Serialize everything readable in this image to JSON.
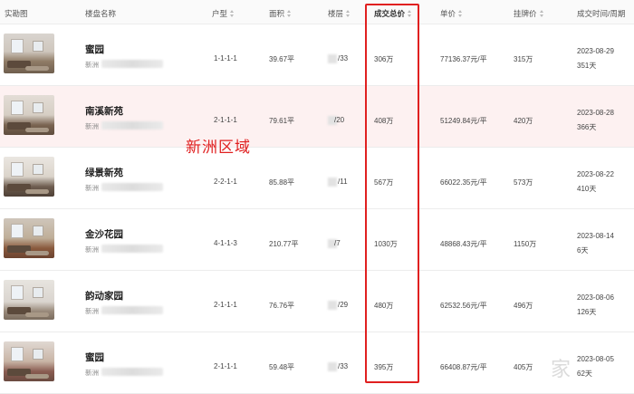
{
  "header": {
    "photo": "实勘图",
    "name": "楼盘名称",
    "layout": "户型",
    "area": "面积",
    "floor": "楼层",
    "total": "成交总价",
    "unit": "单价",
    "list": "挂牌价",
    "time": "成交时间/周期"
  },
  "annotation": "新洲区域",
  "watermark": "家",
  "rows": [
    {
      "name": "蜜园",
      "district": "新洲",
      "layout": "1-1-1-1",
      "area": "39.67平",
      "floor": "/33",
      "total": "306万",
      "unit": "77136.37元/平",
      "list": "315万",
      "date": "2023-08-29",
      "days": "351天"
    },
    {
      "name": "南溪新苑",
      "district": "新洲",
      "layout": "2-1-1-1",
      "area": "79.61平",
      "floor": "/20",
      "total": "408万",
      "unit": "51249.84元/平",
      "list": "420万",
      "date": "2023-08-28",
      "days": "366天"
    },
    {
      "name": "绿景新苑",
      "district": "新洲",
      "layout": "2-2-1-1",
      "area": "85.88平",
      "floor": "/11",
      "total": "567万",
      "unit": "66022.35元/平",
      "list": "573万",
      "date": "2023-08-22",
      "days": "410天"
    },
    {
      "name": "金沙花园",
      "district": "新洲",
      "layout": "4-1-1-3",
      "area": "210.77平",
      "floor": "/7",
      "total": "1030万",
      "unit": "48868.43元/平",
      "list": "1150万",
      "date": "2023-08-14",
      "days": "6天"
    },
    {
      "name": "韵动家园",
      "district": "新洲",
      "layout": "2-1-1-1",
      "area": "76.76平",
      "floor": "/29",
      "total": "480万",
      "unit": "62532.56元/平",
      "list": "496万",
      "date": "2023-08-06",
      "days": "126天"
    },
    {
      "name": "蜜园",
      "district": "新洲",
      "layout": "2-1-1-1",
      "area": "59.48平",
      "floor": "/33",
      "total": "395万",
      "unit": "66408.87元/平",
      "list": "405万",
      "date": "2023-08-05",
      "days": "62天"
    }
  ]
}
